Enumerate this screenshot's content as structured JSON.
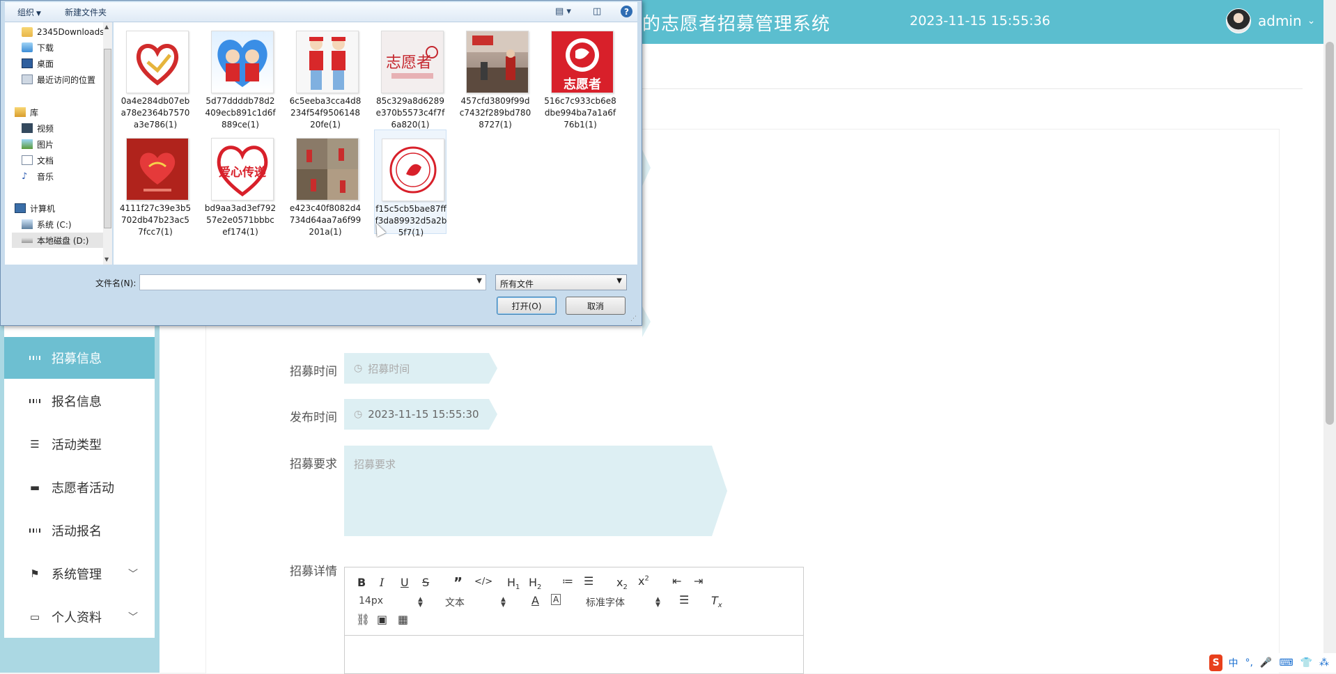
{
  "app": {
    "title": "的志愿者招募管理系统",
    "datetime": "2023-11-15 15:55:36",
    "user": "admin",
    "accent": "#5bbecf"
  },
  "sidebar": {
    "items": [
      {
        "label": "招募信息",
        "icon": "grid-icon",
        "active": true
      },
      {
        "label": "报名信息",
        "icon": "grid-icon"
      },
      {
        "label": "活动类型",
        "icon": "sliders-icon"
      },
      {
        "label": "志愿者活动",
        "icon": "briefcase-icon"
      },
      {
        "label": "活动报名",
        "icon": "grid-icon"
      },
      {
        "label": "系统管理",
        "icon": "flag-icon",
        "expandable": true
      },
      {
        "label": "个人资料",
        "icon": "card-icon",
        "expandable": true
      }
    ]
  },
  "form": {
    "recruit_time_label": "招募时间",
    "recruit_time_placeholder": "招募时间",
    "publish_time_label": "发布时间",
    "publish_time_value": "2023-11-15 15:55:30",
    "requirements_label": "招募要求",
    "requirements_placeholder": "招募要求",
    "details_label": "招募详情"
  },
  "editor": {
    "font_size": "14px",
    "format": "文本",
    "font": "标准字体"
  },
  "dialog": {
    "organize": "组织",
    "new_folder": "新建文件夹",
    "nav": [
      {
        "label": "2345Downloads",
        "icon": "folder-icon"
      },
      {
        "label": "下载",
        "icon": "download-folder-icon"
      },
      {
        "label": "桌面",
        "icon": "desktop-icon"
      },
      {
        "label": "最近访问的位置",
        "icon": "recent-icon"
      },
      {
        "label": "库",
        "icon": "library-icon"
      },
      {
        "label": "视频",
        "icon": "video-icon"
      },
      {
        "label": "图片",
        "icon": "picture-icon"
      },
      {
        "label": "文档",
        "icon": "document-icon"
      },
      {
        "label": "音乐",
        "icon": "music-icon"
      },
      {
        "label": "计算机",
        "icon": "computer-icon"
      },
      {
        "label": "系统 (C:)",
        "icon": "drive-c-icon"
      },
      {
        "label": "本地磁盘 (D:)",
        "icon": "drive-d-icon",
        "selected": true
      }
    ],
    "files": [
      {
        "name": "0a4e284db07eba78e2364b7570a3e786(1)"
      },
      {
        "name": "5d77ddddb78d2409ecb891c1d6f889ce(1)"
      },
      {
        "name": "6c5eeba3cca4d8234f54f950614820fe(1)"
      },
      {
        "name": "85c329a8d6289e370b5573c4f7f6a820(1)",
        "thumb_text": "志愿者"
      },
      {
        "name": "457cfd3809f99dc7432f289bd7808727(1)"
      },
      {
        "name": "516c7c933cb6e8dbe994ba7a1a6f76b1(1)",
        "thumb_text": "志愿者"
      },
      {
        "name": "4111f27c39e3b5702db47b23ac57fcc7(1)"
      },
      {
        "name": "bd9aa3ad3ef79257e2e0571bbbcef174(1)",
        "thumb_text": "爱心传递"
      },
      {
        "name": "e423c40f8082d4734d64aa7a6f99201a(1)"
      },
      {
        "name": "f15c5cb5bae87fff3da89932d5a2b5f7(1)"
      }
    ],
    "filename_label": "文件名(N):",
    "filename_value": "",
    "filetype": "所有文件",
    "open_button": "打开(O)",
    "cancel_button": "取消"
  },
  "ime": {
    "lang": "中"
  }
}
